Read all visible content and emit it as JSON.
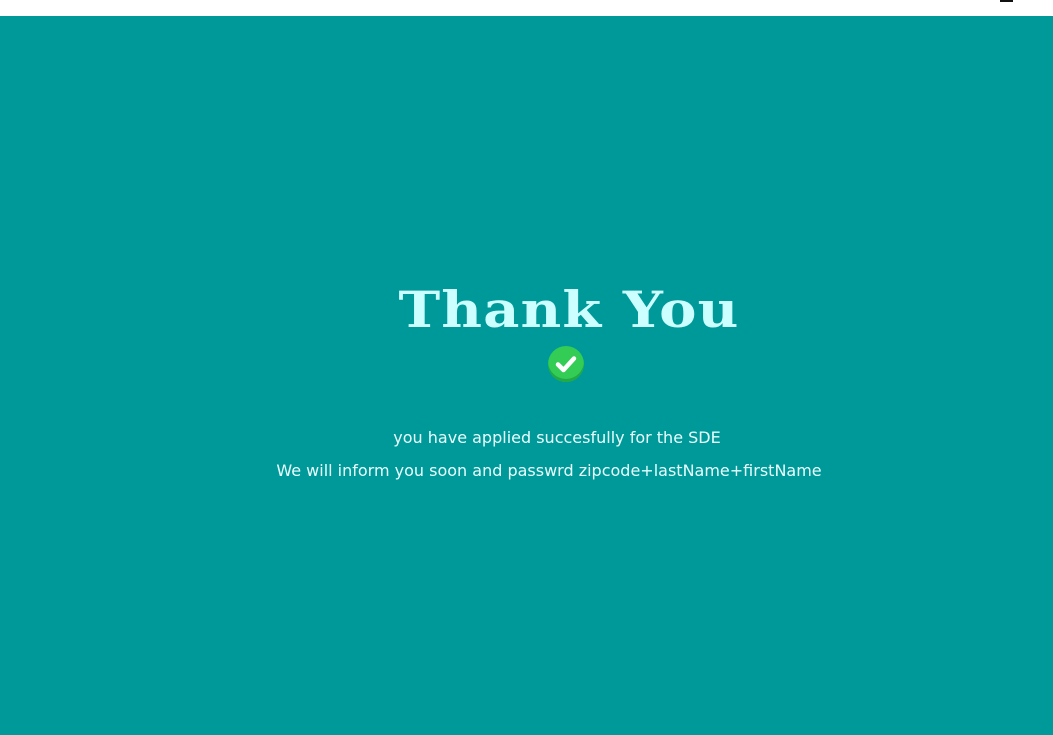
{
  "colors": {
    "background": "#009999",
    "title": "#ccffff",
    "message": "#e8ffff",
    "check_badge": "#33cc55"
  },
  "confirmation": {
    "title": "Thank You",
    "icon": "check-circle-icon",
    "message_line_1": "you have applied succesfully for the SDE",
    "message_line_2": "We will inform you soon and passwrd zipcode+lastName+firstName"
  }
}
